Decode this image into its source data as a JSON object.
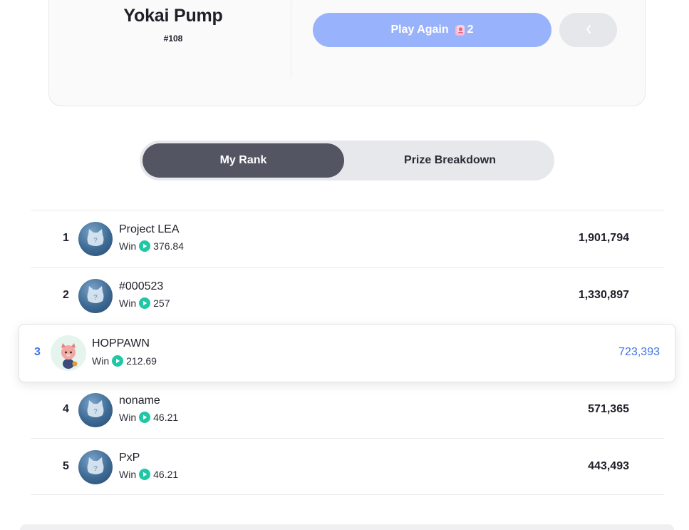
{
  "game": {
    "title": "Yokai Pump",
    "id": "#108",
    "play_again_label": "Play Again",
    "play_count": "2",
    "accent_color": "#98b2fb"
  },
  "tabs": [
    {
      "label": "My Rank",
      "active": true
    },
    {
      "label": "Prize Breakdown",
      "active": false
    }
  ],
  "ranking": {
    "win_label": "Win",
    "rows": [
      {
        "rank": "1",
        "name": "Project LEA",
        "win": "376.84",
        "score": "1,901,794",
        "avatar": "placeholder-cat-icon"
      },
      {
        "rank": "2",
        "name": "#000523",
        "win": "257",
        "score": "1,330,897",
        "avatar": "placeholder-cat-icon"
      },
      {
        "rank": "3",
        "name": "HOPPAWN",
        "win": "212.69",
        "score": "723,393",
        "avatar": "hoppawn-avatar",
        "is_me": true
      },
      {
        "rank": "4",
        "name": "noname",
        "win": "46.21",
        "score": "571,365",
        "avatar": "placeholder-cat-icon"
      },
      {
        "rank": "5",
        "name": "PxP",
        "win": "46.21",
        "score": "443,493",
        "avatar": "placeholder-cat-icon"
      }
    ],
    "highlight_color": "#3f72e6",
    "win_icon_color": "#1fc7a4"
  }
}
